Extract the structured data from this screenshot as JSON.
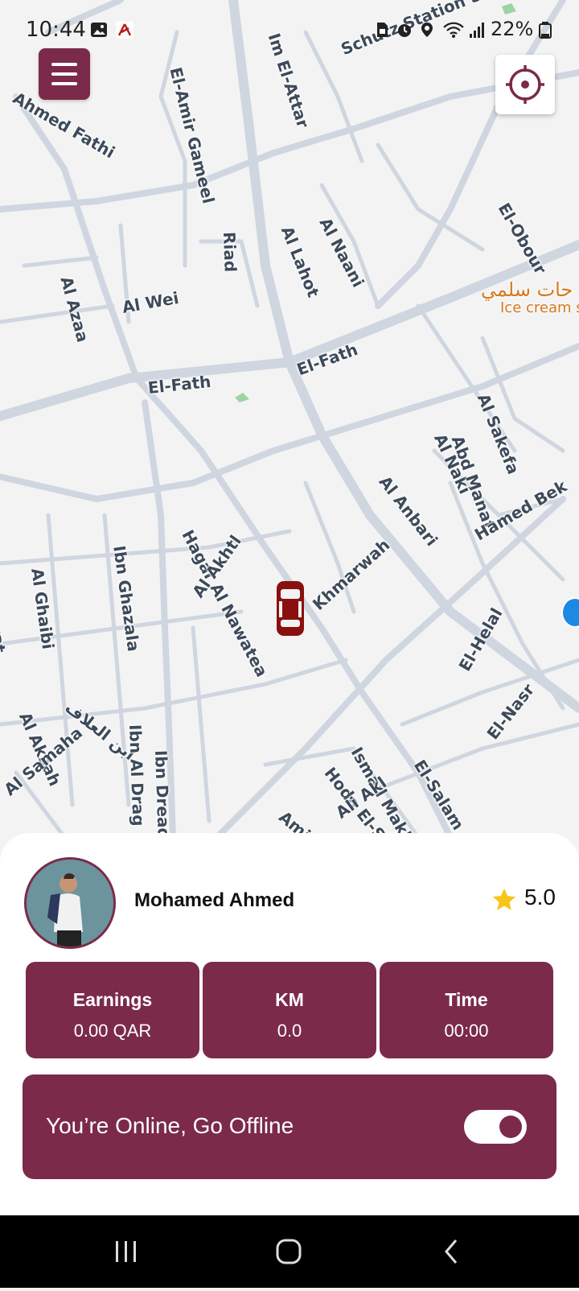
{
  "status_bar": {
    "time": "10:44",
    "battery": "22%",
    "icons": [
      "image-icon",
      "app-icon",
      "sim-icon",
      "alarm-icon",
      "location-icon",
      "wifi-icon",
      "signal-icon",
      "battery-icon"
    ]
  },
  "map": {
    "street_labels": [
      "El-Amir Gameel",
      "Im El-Attar",
      "Schutz Station St",
      "Ahmed Fathi",
      "Riad",
      "Al Lahot",
      "Al Naani",
      "El-Fath",
      "El-Obour",
      "Al Azaa",
      "Al Wei",
      "El-Fath",
      "Hagar Al Nawatea",
      "Ibn Ghazala",
      "Al Akhtl",
      "Khmarwah",
      "Al Anbari",
      "Al Naki",
      "Abd Manaf",
      "Al Sakefa",
      "Hamed Bek",
      "Qanawat",
      "Al Ghaibi",
      "Al Aksah",
      "ابن العلاف",
      "Ibn Al Drag",
      "Ibn Dread",
      "Al Samaha",
      "Ismail Makhlouf",
      "Hoda El-Shaarawy",
      "Ali Akl",
      "El-Salam",
      "El-Nasr",
      "El-Helal",
      "Amina"
    ],
    "poi_name_ar": "حات سلمي",
    "poi_name_en": "Ice cream s",
    "icons": [
      "menu-icon",
      "locate-icon",
      "car-icon"
    ]
  },
  "driver": {
    "name": "Mohamed Ahmed",
    "rating": "5.0"
  },
  "stats": [
    {
      "title": "Earnings",
      "value": "0.00 QAR"
    },
    {
      "title": "KM",
      "value": "0.0"
    },
    {
      "title": "Time",
      "value": "00:00"
    }
  ],
  "online": {
    "text": "You’re Online, Go Offline",
    "toggle_on": true
  },
  "colors": {
    "accent": "#7b2a4a",
    "star": "#f5c518",
    "map_bg": "#f3f3f4",
    "road": "#cfd6df"
  }
}
